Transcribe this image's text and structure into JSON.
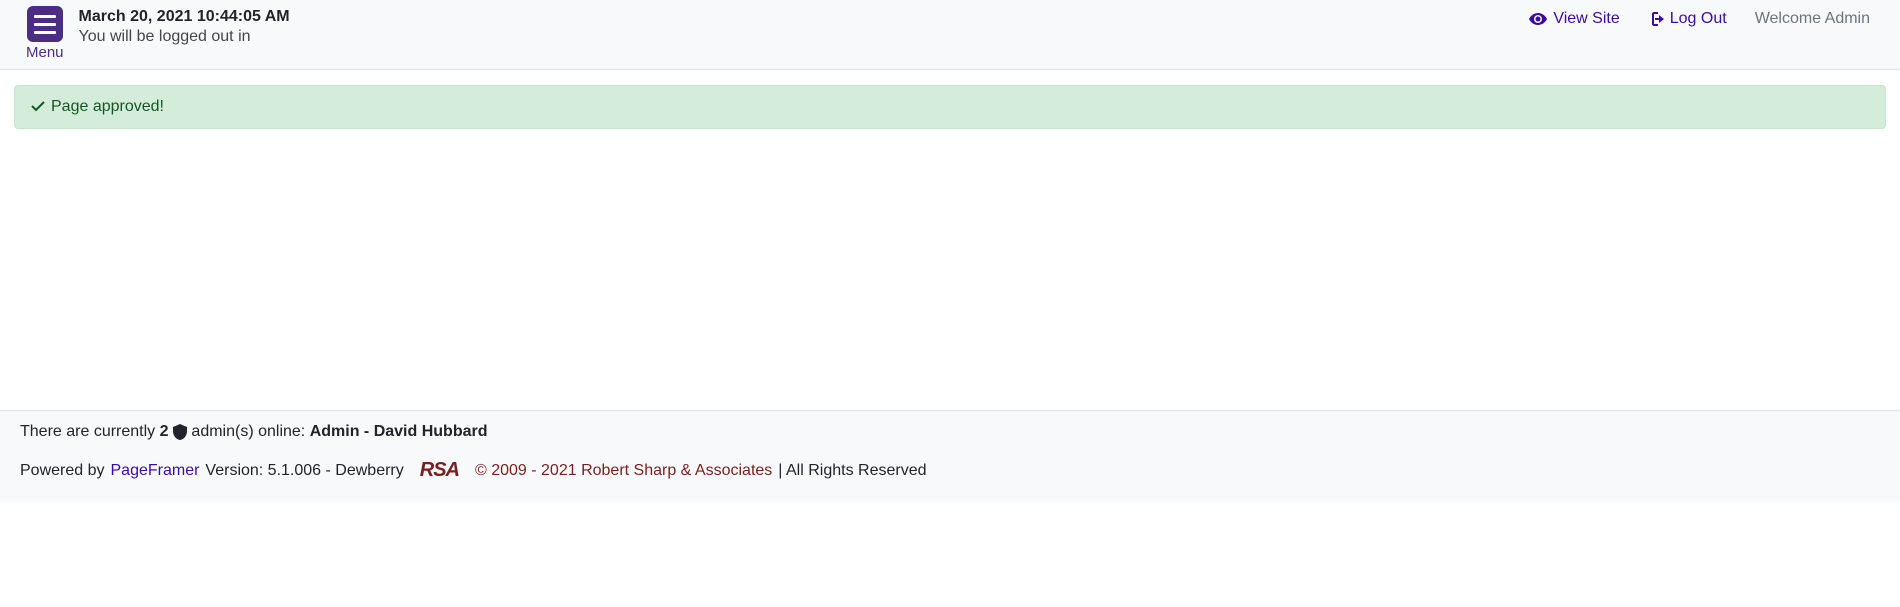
{
  "header": {
    "menu_label": "Menu",
    "datetime": "March 20, 2021 10:44:05 AM",
    "logout_msg": "You will be logged out in",
    "view_site": "View Site",
    "log_out": "Log Out",
    "welcome": "Welcome Admin"
  },
  "alert": {
    "message": "Page approved!"
  },
  "footer": {
    "prefix": "There are currently ",
    "admin_count": "2",
    "middle": " admin(s) online: ",
    "admin_names": "Admin - David Hubbard",
    "powered_by": "Powered by ",
    "pageframer": "PageFramer",
    "version": " Version: 5.1.006 - Dewberry",
    "rsa": "RSA",
    "copyright": "© 2009 - 2021 Robert Sharp & Associates",
    "rights": " | All Rights Reserved"
  }
}
